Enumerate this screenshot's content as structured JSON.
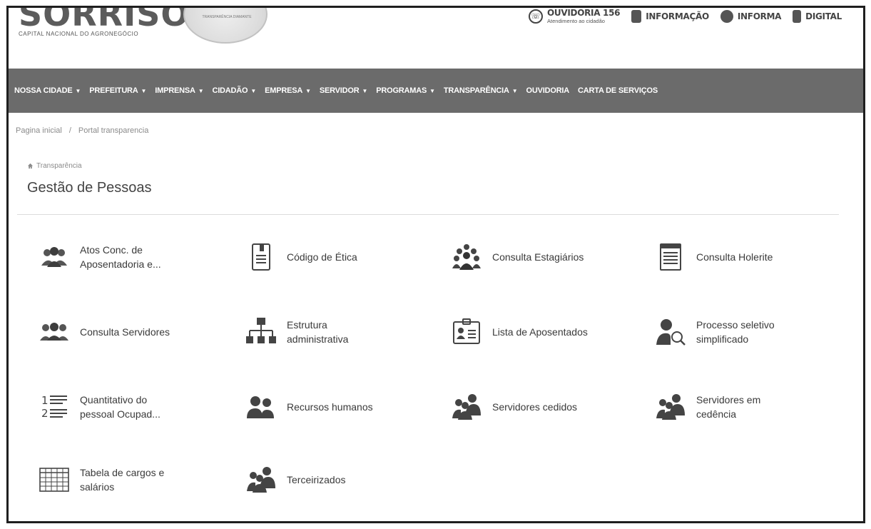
{
  "header": {
    "logo_word": "SORRISO",
    "logo_sub": "CAPITAL NACIONAL DO AGRONEGÓCIO",
    "seal_text": "TRANSPARÊNCIA DIAMANTE",
    "links": [
      {
        "label": "OUVIDORIA 156",
        "sub": "Atendimento ao cidadão",
        "icon": "phone-icon"
      },
      {
        "label": "INFORMAÇÃO",
        "icon": "info-icon"
      },
      {
        "label": "INFORMA",
        "icon": "whatsapp-icon"
      },
      {
        "label": "DIGITAL",
        "icon": "hand-icon"
      }
    ]
  },
  "nav": {
    "items": [
      {
        "label": "NOSSA CIDADE",
        "caret": "▼"
      },
      {
        "label": "PREFEITURA",
        "caret": "▼"
      },
      {
        "label": "IMPRENSA",
        "caret": "▼"
      },
      {
        "label": "CIDADÃO",
        "caret": "▼"
      },
      {
        "label": "EMPRESA",
        "caret": "▼"
      },
      {
        "label": "SERVIDOR",
        "caret": "▼"
      },
      {
        "label": "PROGRAMAS",
        "caret": "▼"
      },
      {
        "label": "TRANSPARÊNCIA",
        "caret": "▼"
      },
      {
        "label": "OUVIDORIA",
        "caret": ""
      },
      {
        "label": "CARTA DE SERVIÇOS",
        "caret": ""
      }
    ]
  },
  "breadcrumb": {
    "home": "Pagina inicial",
    "sep": "/",
    "current": "Portal transparencia"
  },
  "section": {
    "kicker": "Transparência",
    "title": "Gestão de Pessoas"
  },
  "items": [
    {
      "line1": "Atos Conc. de",
      "line2": "Aposentadoria e...",
      "icon": "group-icon"
    },
    {
      "line1": "Código de Ética",
      "line2": "",
      "icon": "document-icon"
    },
    {
      "line1": "Consulta Estagiários",
      "line2": "",
      "icon": "crowd-icon"
    },
    {
      "line1": "Consulta Holerite",
      "line2": "",
      "icon": "sheet-icon"
    },
    {
      "line1": "Consulta Servidores",
      "line2": "",
      "icon": "group-icon"
    },
    {
      "line1": "Estrutura",
      "line2": "administrativa",
      "icon": "org-chart-icon"
    },
    {
      "line1": "Lista de Aposentados",
      "line2": "",
      "icon": "id-card-icon"
    },
    {
      "line1": "Processo seletivo",
      "line2": "simplificado",
      "icon": "user-search-icon"
    },
    {
      "line1": "Quantitativo do",
      "line2": "pessoal Ocupad...",
      "icon": "numbered-list-icon"
    },
    {
      "line1": "Recursos humanos",
      "line2": "",
      "icon": "pair-icon"
    },
    {
      "line1": "Servidores cedidos",
      "line2": "",
      "icon": "trio-icon"
    },
    {
      "line1": "Servidores em",
      "line2": "cedência",
      "icon": "trio-icon"
    },
    {
      "line1": "Tabela de cargos e",
      "line2": "salários",
      "icon": "table-grid-icon"
    },
    {
      "line1": "Terceirizados",
      "line2": "",
      "icon": "trio-icon"
    }
  ]
}
